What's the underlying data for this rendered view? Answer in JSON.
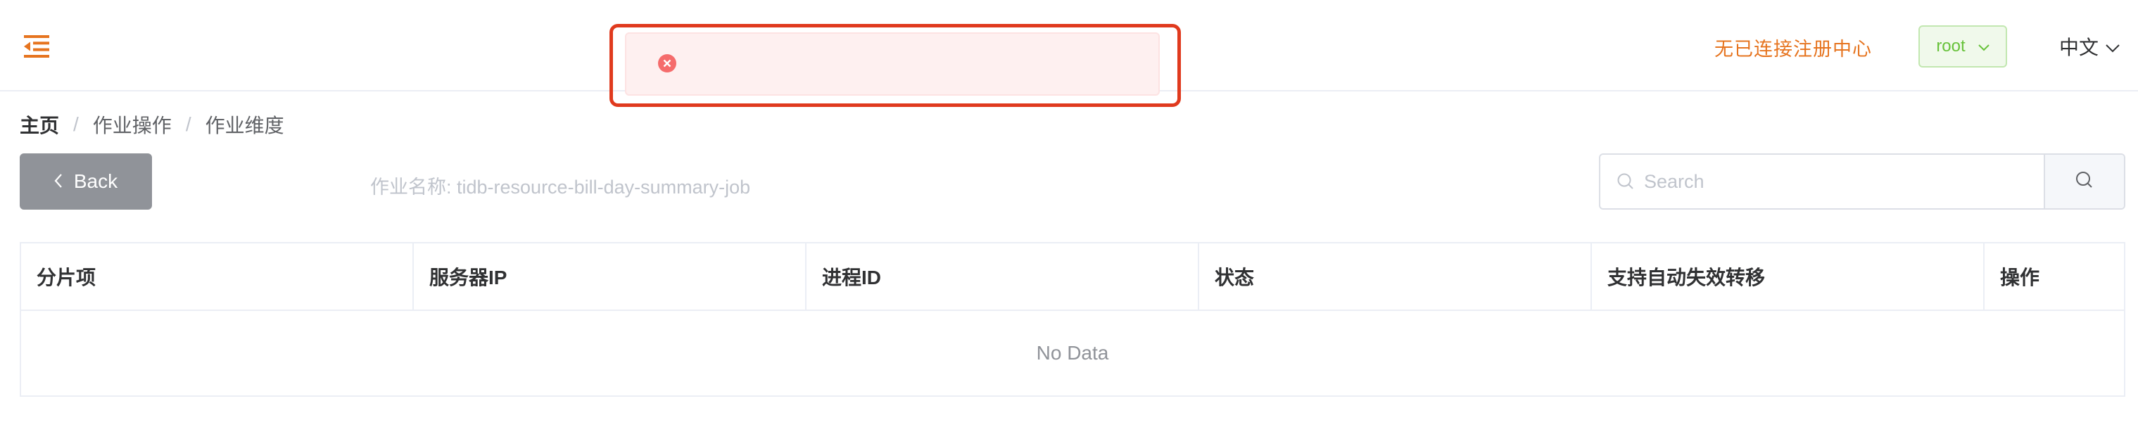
{
  "header": {
    "menu_toggle_icon": "menu-fold-icon",
    "registry_status": "无已连接注册中心",
    "user": {
      "name": "root",
      "icon": "chevron-down-icon"
    },
    "language": {
      "label": "中文",
      "icon": "chevron-down-icon"
    }
  },
  "message": {
    "type": "error",
    "icon": "circle-close-icon",
    "text": ""
  },
  "breadcrumb": {
    "home": "主页",
    "items": [
      "作业操作",
      "作业维度"
    ],
    "separator": "/"
  },
  "toolbar": {
    "back_label": "Back",
    "back_icon": "chevron-left-icon",
    "job_name": "作业名称: tidb-resource-bill-day-summary-job",
    "search": {
      "placeholder": "Search",
      "value": "",
      "prefix_icon": "search-icon",
      "button_icon": "search-icon"
    }
  },
  "table": {
    "columns": [
      "分片项",
      "服务器IP",
      "进程ID",
      "状态",
      "支持自动失效转移",
      "操作"
    ],
    "rows": [],
    "empty_text": "No Data"
  },
  "colors": {
    "accent_orange": "#e6741f",
    "error_red": "#f56c6c",
    "highlight_frame": "#e03a1e",
    "success_green": "#67c23a",
    "back_button_gray": "#909399"
  }
}
